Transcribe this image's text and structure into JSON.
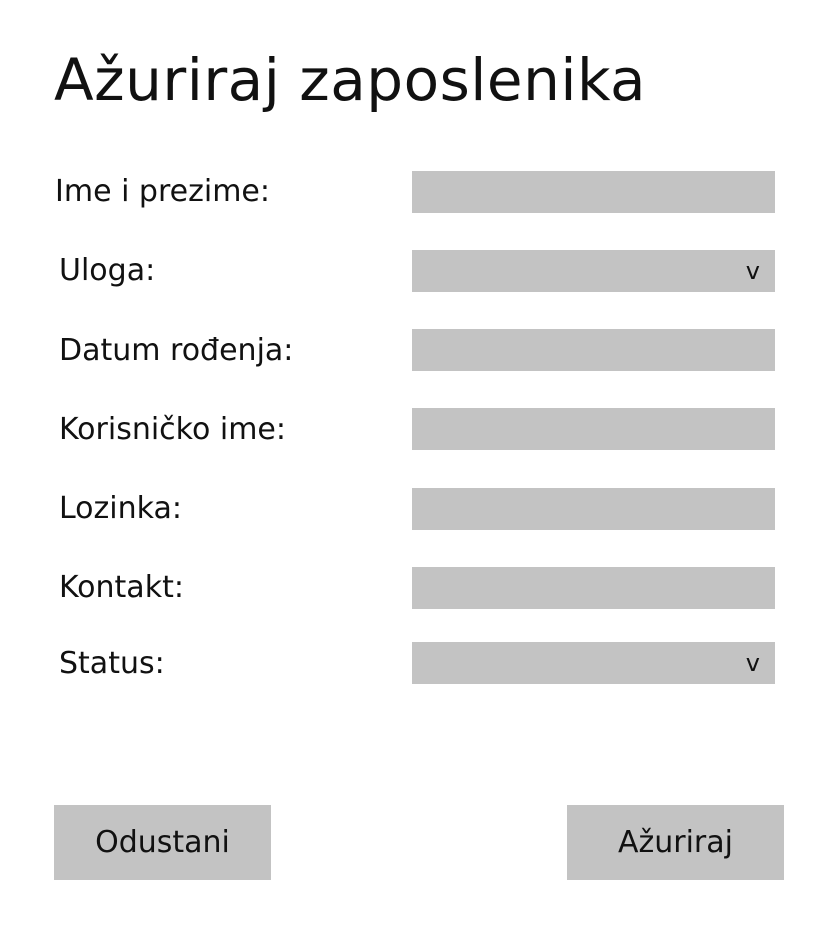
{
  "title": "Ažuriraj zaposlenika",
  "form": {
    "fields": [
      {
        "label": "Ime i prezime:",
        "value": "",
        "type": "text"
      },
      {
        "label": "Uloga:",
        "value": "",
        "type": "select",
        "icon": "chevron-down-icon",
        "icon_glyph": "v"
      },
      {
        "label": "Datum rođenja:",
        "value": "",
        "type": "text"
      },
      {
        "label": "Korisničko ime:",
        "value": "",
        "type": "text"
      },
      {
        "label": "Lozinka:",
        "value": "",
        "type": "password"
      },
      {
        "label": "Kontakt:",
        "value": "",
        "type": "text"
      },
      {
        "label": "Status:",
        "value": "",
        "type": "select",
        "icon": "chevron-down-icon",
        "icon_glyph": "v"
      }
    ]
  },
  "buttons": {
    "cancel_label": "Odustani",
    "submit_label": "Ažuriraj"
  },
  "colors": {
    "field_background": "#c3c3c3",
    "button_background": "#c3c3c3",
    "text": "#111111",
    "page_background": "#ffffff"
  }
}
